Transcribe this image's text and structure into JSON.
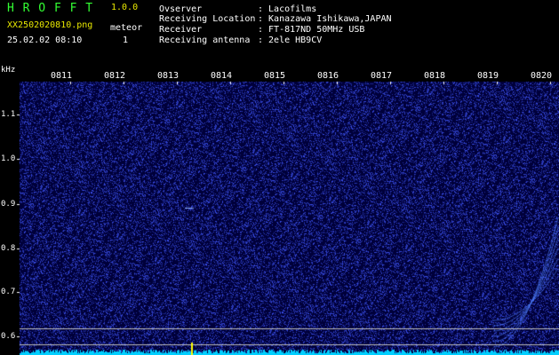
{
  "app": {
    "name": "H R O F F T",
    "version": "1.0.0"
  },
  "file": {
    "name": "XX2502020810.png",
    "datetime": "25.02.02 08:10"
  },
  "meteor": {
    "label": "meteor",
    "count": "1"
  },
  "info": {
    "labels": [
      "Ovserver",
      "Receiving Location",
      "Receiver",
      "Receiving antenna"
    ],
    "values": [
      ": Lacofilms",
      ": Kanazawa Ishikawa,JAPAN",
      ": FT-817ND 50MHz USB",
      ": 2ele HB9CV"
    ]
  },
  "plot": {
    "y_unit": "kHz",
    "y_ticks": [
      "1.1",
      "1.0",
      "0.9",
      "0.8",
      "0.7",
      "0.6"
    ],
    "x_ticks": [
      "0811",
      "0812",
      "0813",
      "0814",
      "0815",
      "0816",
      "0817",
      "0818",
      "0819",
      "0820"
    ],
    "background_color": "#00003a",
    "noise_color": "#2233aa",
    "baseline_color": "#00cfff",
    "guide_line_color": "#bfbfbf",
    "meteor_color": "#ffff00"
  }
}
